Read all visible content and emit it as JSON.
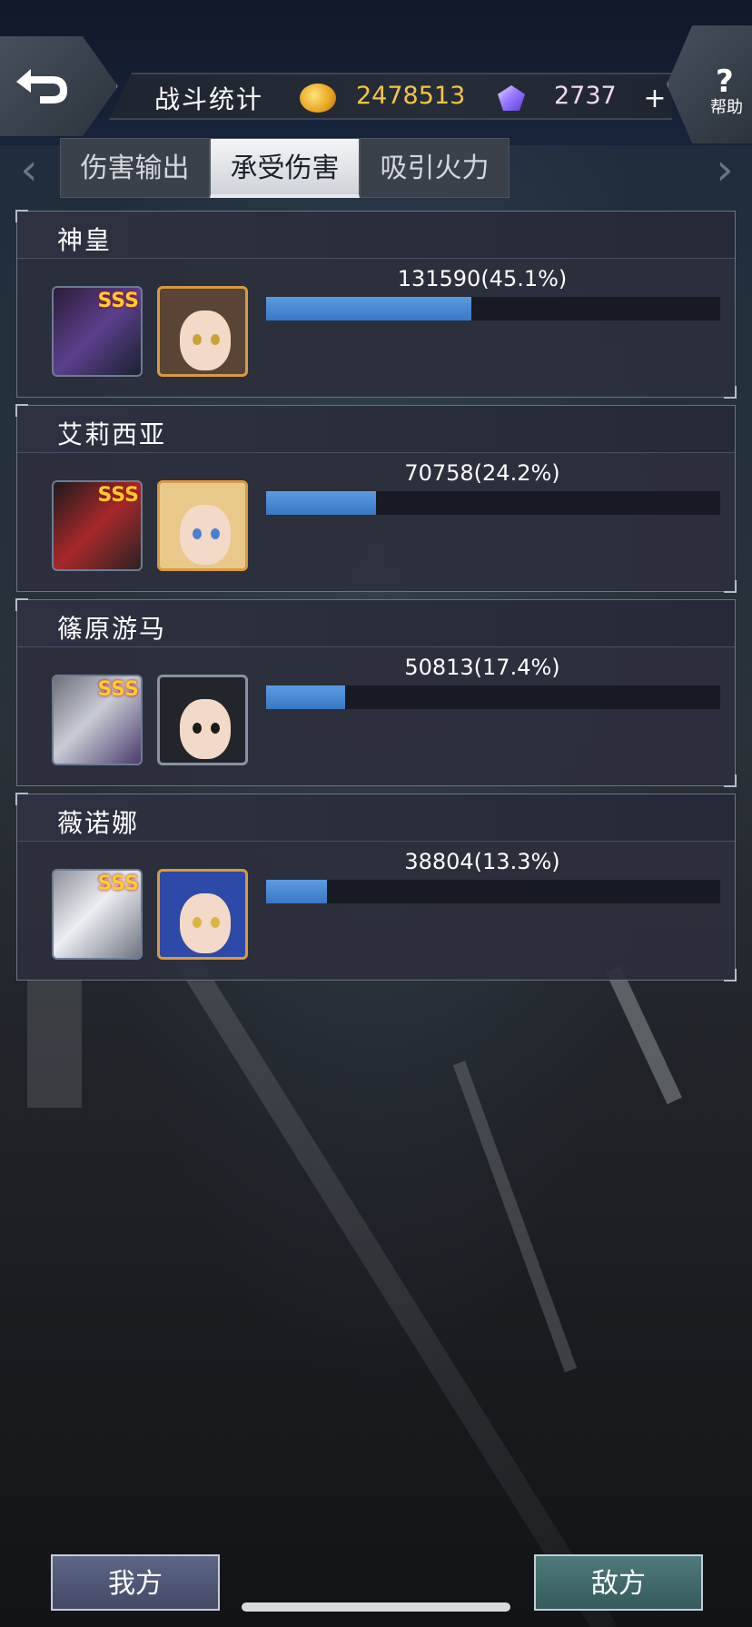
{
  "header": {
    "title": "战斗统计",
    "coins": "2478513",
    "gems": "2737",
    "plus_label": "+",
    "help_icon": "?",
    "help_label": "帮助"
  },
  "tabs": [
    {
      "label": "伤害输出",
      "active": false
    },
    {
      "label": "承受伤害",
      "active": true
    },
    {
      "label": "吸引火力",
      "active": false
    }
  ],
  "players": [
    {
      "name": "神皇",
      "value": "131590(45.1%)",
      "fraction": 0.451,
      "rank": "SSS",
      "pilot_color": "#5a4436",
      "eye_color": "#c9a23a"
    },
    {
      "name": "艾莉西亚",
      "value": "70758(24.2%)",
      "fraction": 0.242,
      "rank": "SSS",
      "pilot_color": "#e8c98a",
      "eye_color": "#4a7fd1"
    },
    {
      "name": "篠原游马",
      "value": "50813(17.4%)",
      "fraction": 0.174,
      "rank": "SSS",
      "pilot_color": "#23252c",
      "eye_color": "#1a1a1a"
    },
    {
      "name": "薇诺娜",
      "value": "38804(13.3%)",
      "fraction": 0.133,
      "rank": "SSS",
      "pilot_color": "#2d4aa8",
      "eye_color": "#d8b640"
    }
  ],
  "bottom": {
    "ours_label": "我方",
    "enemy_label": "敌方"
  },
  "colors": {
    "bar_fill": "#4a8ad6",
    "coin": "#f5c544",
    "active_tab": "#e6e8ec"
  }
}
